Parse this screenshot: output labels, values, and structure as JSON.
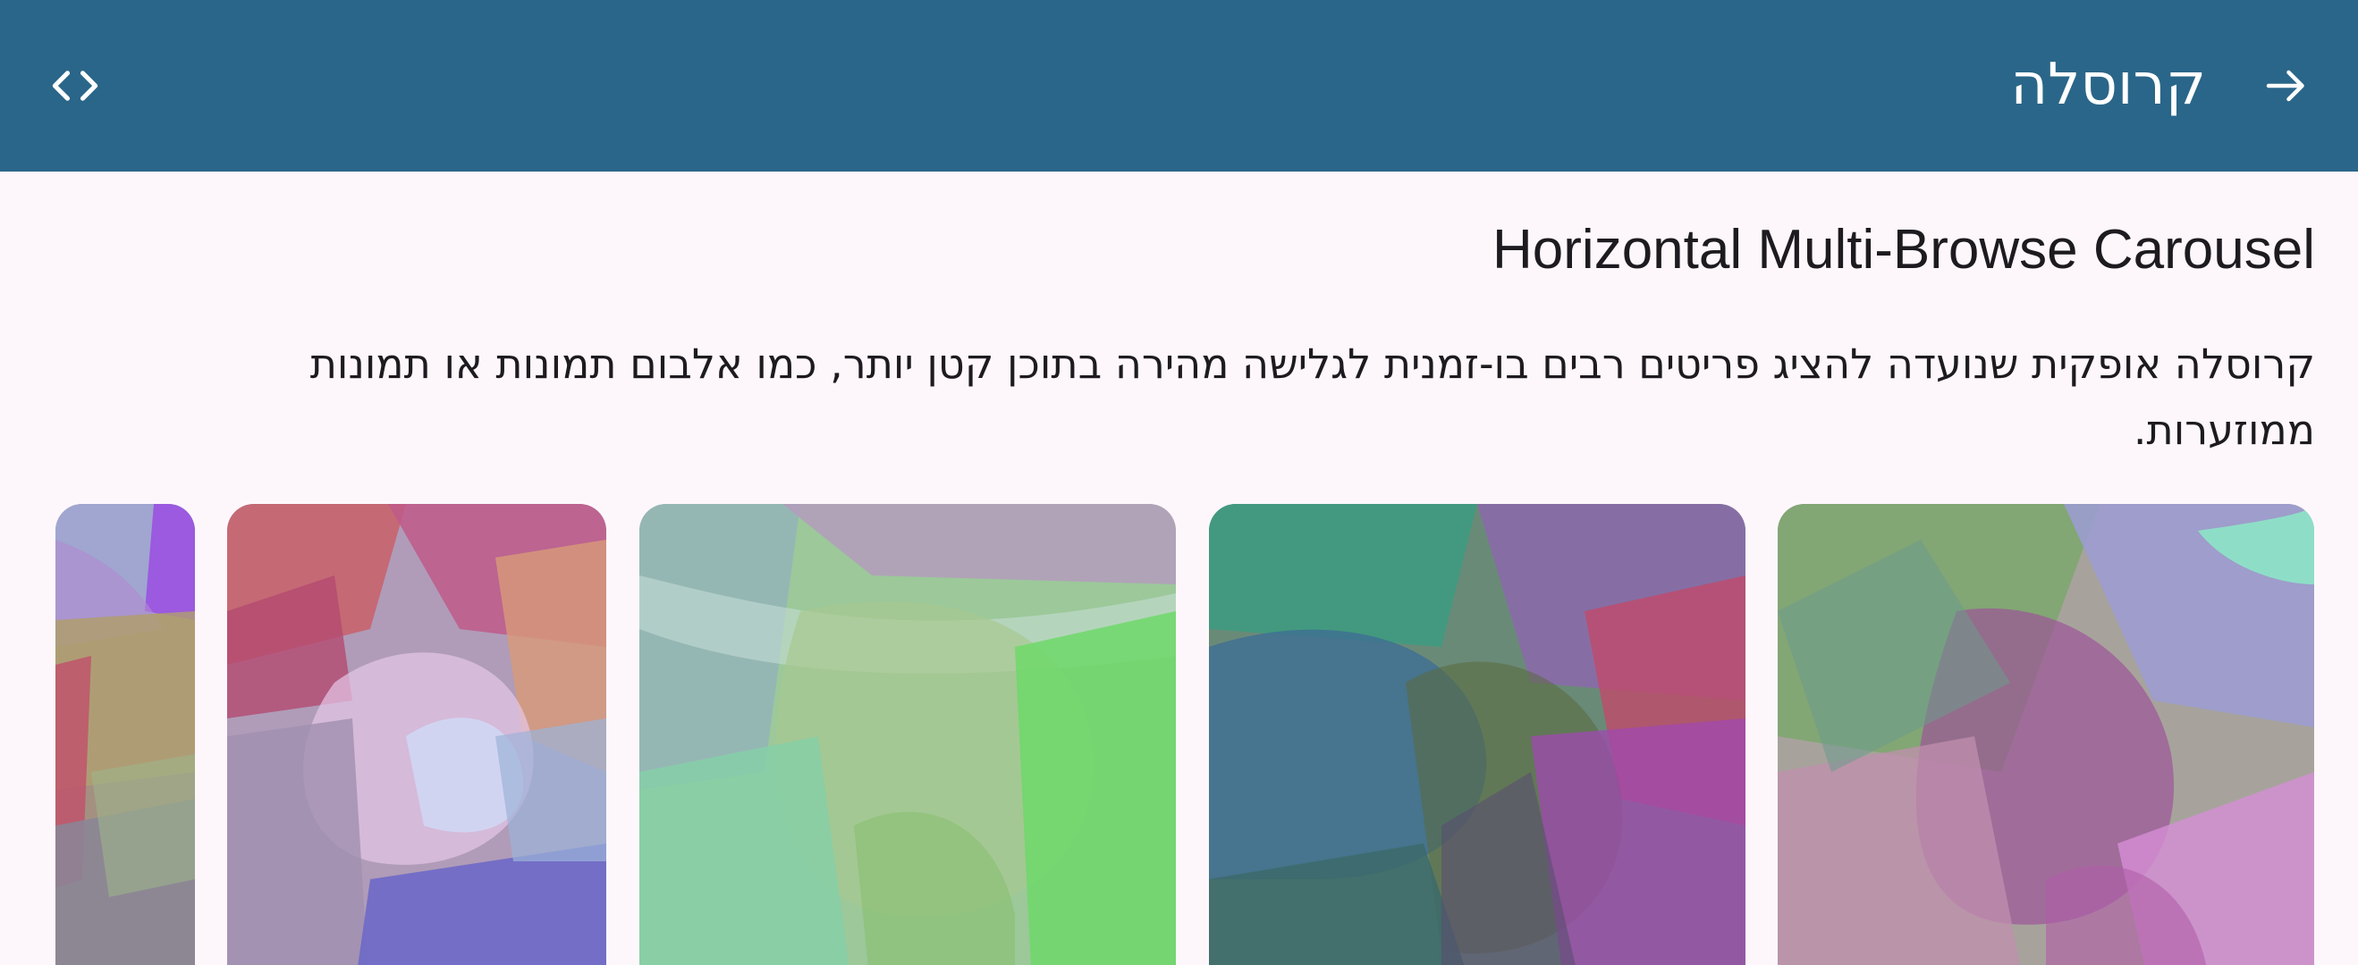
{
  "app_bar": {
    "title": "קרוסלה",
    "back_icon": "arrow-right-icon",
    "code_icon": "code-icon",
    "background": "#2a6689"
  },
  "content": {
    "heading": "Horizontal Multi-Browse Carousel",
    "description": "קרוסלה אופקית שנועדה להציג פריטים רבים בו-זמנית לגלישה מהירה בתוכן קטן יותר, כמו אלבום תמונות או תמונות ממוזערות."
  },
  "carousel": {
    "item_count_visible": 5
  }
}
